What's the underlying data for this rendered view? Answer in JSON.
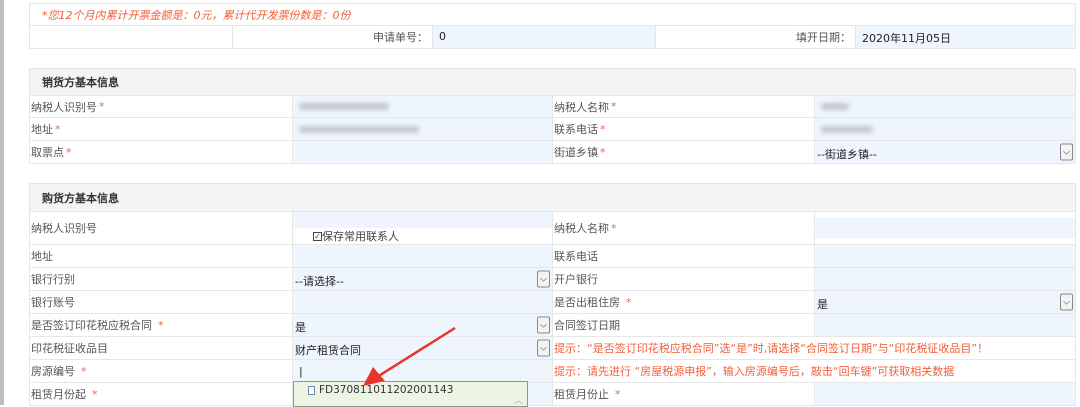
{
  "notice": "*您12个月内累计开票金额是：0元，累计代开发票份数是：0份",
  "apply": {
    "no_label": "申请单号：",
    "no_value": "0",
    "date_label": "填开日期：",
    "date_value": "2020年11月05日"
  },
  "seller": {
    "title": "销货方基本信息",
    "taxid_label": "纳税人识别号",
    "name_label": "纳税人名称",
    "addr_label": "地址",
    "phone_label": "联系电话",
    "pickup_label": "取票点",
    "street_label": "街道乡镇",
    "street_value": "--街道乡镇--"
  },
  "buyer": {
    "title": "购货方基本信息",
    "taxid_label": "纳税人识别号",
    "save_contact_label": "保存常用联系人",
    "save_contact_checked": true,
    "name_label": "纳税人名称",
    "addr_label": "地址",
    "phone_label": "联系电话",
    "bank_type_label": "银行行别",
    "bank_type_value": "--请选择--",
    "bank_label": "开户银行",
    "account_label": "银行账号",
    "rent_house_label": "是否出租住房",
    "rent_house_value": "是",
    "stamp_contract_label": "是否签订印花税应税合同",
    "stamp_contract_value": "是",
    "contract_date_label": "合同签订日期",
    "stamp_item_label": "印花税征收品目",
    "stamp_item_value": "财产租赁合同",
    "tip1": "提示：“是否签订印花税应税合同”选“是”时,请选择“合同签订日期”与“印花税征收品目”！",
    "house_no_label": "房源编号",
    "house_no_value": "|",
    "tip2": "提示：请先进行 “房屋税源申报”，输入房源编号后，敲击“回车键”可获取相关数据",
    "rent_start_label": "租赁月份起",
    "rent_end_label": "租赁月份止",
    "suggestion": "FD370811011202001143"
  },
  "req_mark": "*",
  "colors": {
    "tip": "#f0603a",
    "value_bg": "#eef5fd",
    "arrow": "#e8352a"
  }
}
